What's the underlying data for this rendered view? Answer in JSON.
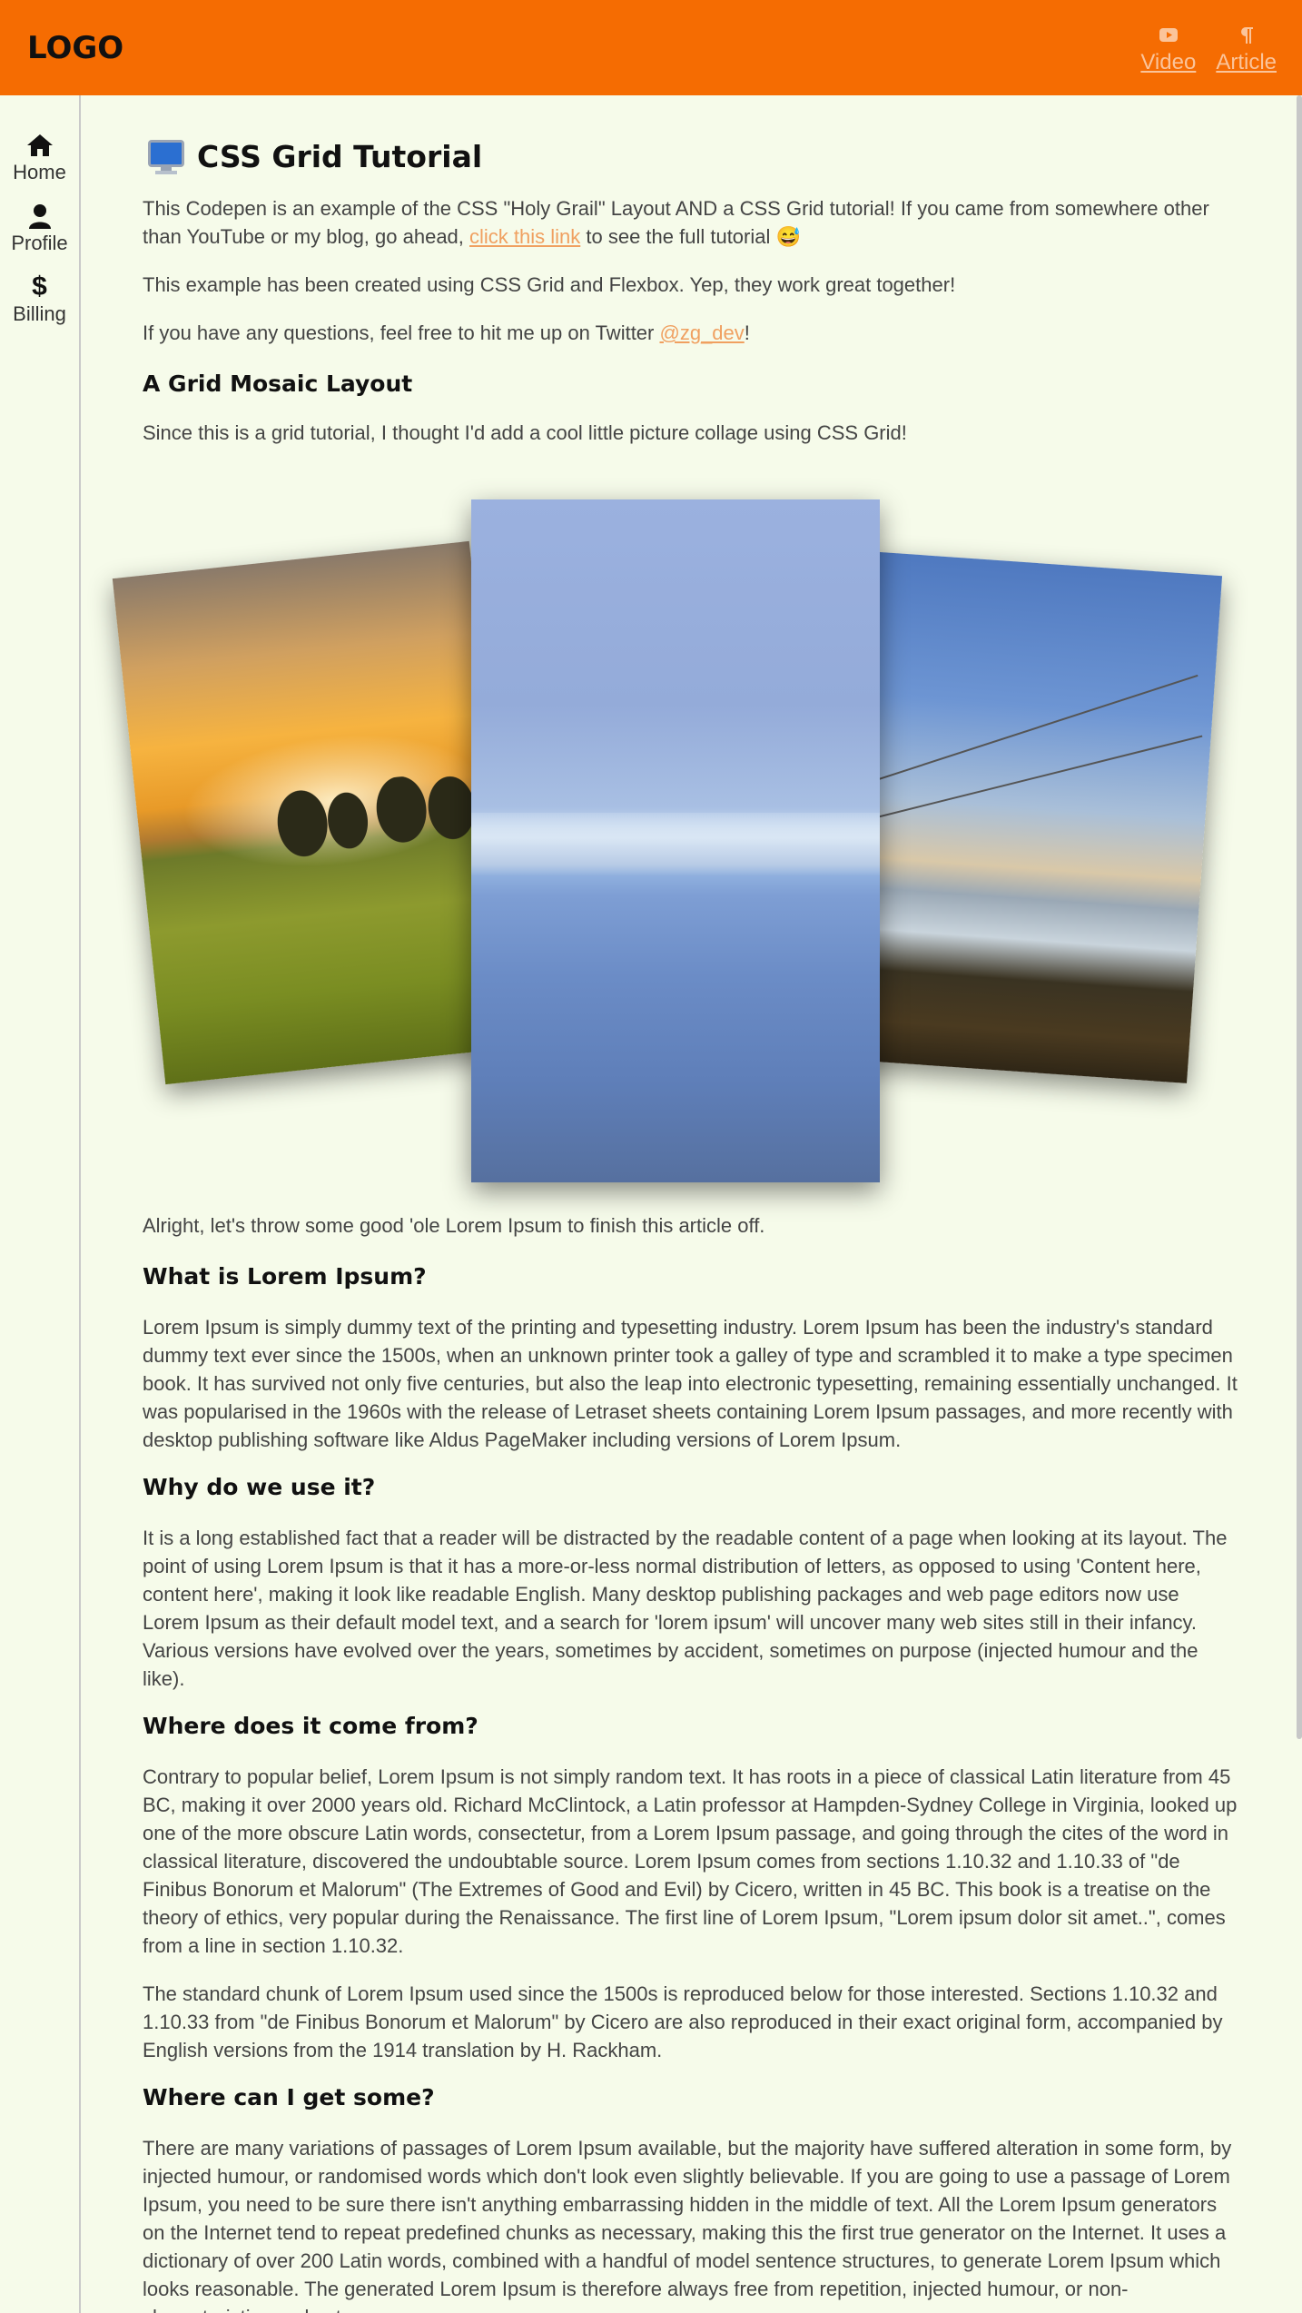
{
  "header": {
    "logo": "LOGO",
    "links": [
      {
        "label": "Video",
        "icon": "youtube-icon"
      },
      {
        "label": "Article",
        "icon": "paragraph-icon"
      }
    ]
  },
  "sidebar": {
    "items": [
      {
        "label": "Home",
        "icon": "home-icon"
      },
      {
        "label": "Profile",
        "icon": "user-icon"
      },
      {
        "label": "Billing",
        "icon": "dollar-icon"
      }
    ]
  },
  "main": {
    "title": "CSS Grid Tutorial",
    "intro": {
      "p1_before": "This Codepen is an example of the CSS \"Holy Grail\" Layout AND a CSS Grid tutorial! If you came from somewhere other than YouTube or my blog, go ahead, ",
      "p1_link": "click this link",
      "p1_after": " to see the full tutorial 😅",
      "p2": "This example has been created using CSS Grid and Flexbox. Yep, they work great together!",
      "p3_before": "If you have any questions, feel free to hit me up on Twitter ",
      "p3_link": "@zg_dev",
      "p3_after": "!"
    },
    "mosaic": {
      "heading": "A Grid Mosaic Layout",
      "text": "Since this is a grid tutorial, I thought I'd add a cool little picture collage using CSS Grid!"
    },
    "lorem_intro": "Alright, let's throw some good 'ole Lorem Ipsum to finish this article off.",
    "sections": [
      {
        "heading": "What is Lorem Ipsum?",
        "paragraphs": [
          "Lorem Ipsum is simply dummy text of the printing and typesetting industry. Lorem Ipsum has been the industry's standard dummy text ever since the 1500s, when an unknown printer took a galley of type and scrambled it to make a type specimen book. It has survived not only five centuries, but also the leap into electronic typesetting, remaining essentially unchanged. It was popularised in the 1960s with the release of Letraset sheets containing Lorem Ipsum passages, and more recently with desktop publishing software like Aldus PageMaker including versions of Lorem Ipsum."
        ]
      },
      {
        "heading": "Why do we use it?",
        "paragraphs": [
          "It is a long established fact that a reader will be distracted by the readable content of a page when looking at its layout. The point of using Lorem Ipsum is that it has a more-or-less normal distribution of letters, as opposed to using 'Content here, content here', making it look like readable English. Many desktop publishing packages and web page editors now use Lorem Ipsum as their default model text, and a search for 'lorem ipsum' will uncover many web sites still in their infancy. Various versions have evolved over the years, sometimes by accident, sometimes on purpose (injected humour and the like)."
        ]
      },
      {
        "heading": "Where does it come from?",
        "paragraphs": [
          "Contrary to popular belief, Lorem Ipsum is not simply random text. It has roots in a piece of classical Latin literature from 45 BC, making it over 2000 years old. Richard McClintock, a Latin professor at Hampden-Sydney College in Virginia, looked up one of the more obscure Latin words, consectetur, from a Lorem Ipsum passage, and going through the cites of the word in classical literature, discovered the undoubtable source. Lorem Ipsum comes from sections 1.10.32 and 1.10.33 of \"de Finibus Bonorum et Malorum\" (The Extremes of Good and Evil) by Cicero, written in 45 BC. This book is a treatise on the theory of ethics, very popular during the Renaissance. The first line of Lorem Ipsum, \"Lorem ipsum dolor sit amet..\", comes from a line in section 1.10.32.",
          "The standard chunk of Lorem Ipsum used since the 1500s is reproduced below for those interested. Sections 1.10.32 and 1.10.33 from \"de Finibus Bonorum et Malorum\" by Cicero are also reproduced in their exact original form, accompanied by English versions from the 1914 translation by H. Rackham."
        ]
      },
      {
        "heading": "Where can I get some?",
        "paragraphs": [
          "There are many variations of passages of Lorem Ipsum available, but the majority have suffered alteration in some form, by injected humour, or randomised words which don't look even slightly believable. If you are going to use a passage of Lorem Ipsum, you need to be sure there isn't anything embarrassing hidden in the middle of text. All the Lorem Ipsum generators on the Internet tend to repeat predefined chunks as necessary, making this the first true generator on the Internet. It uses a dictionary of over 200 Latin words, combined with a handful of model sentence structures, to generate Lorem Ipsum which looks reasonable. The generated Lorem Ipsum is therefore always free from repetition, injected humour, or non-characteristic words etc."
        ]
      }
    ]
  },
  "colors": {
    "header_bg": "#f56c02",
    "page_bg": "#f6fbea",
    "link": "#f0a060"
  }
}
